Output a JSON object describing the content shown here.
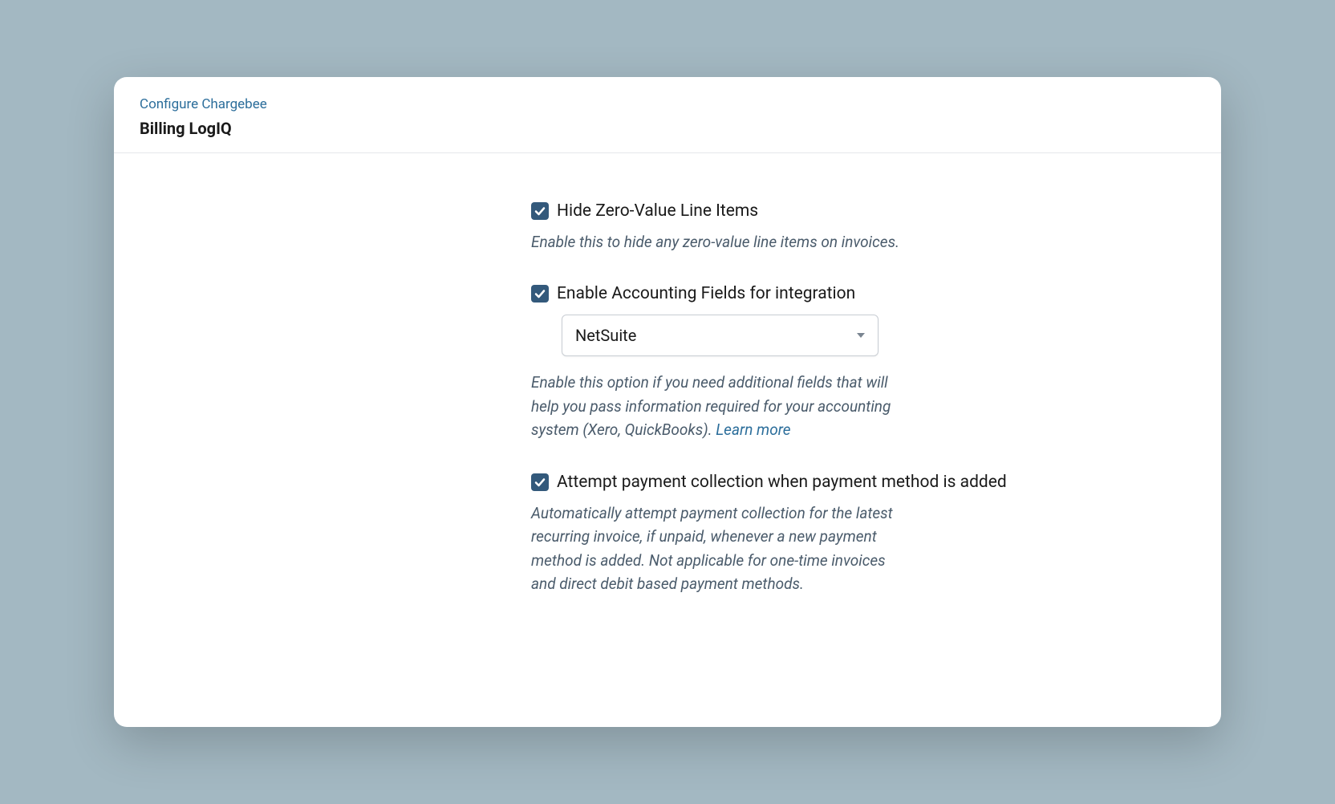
{
  "header": {
    "breadcrumb": "Configure Chargebee",
    "title": "Billing LogIQ"
  },
  "settings": {
    "hideZeroValue": {
      "label": "Hide Zero-Value Line Items",
      "description": "Enable this to hide any zero-value line items on invoices.",
      "checked": true
    },
    "accountingFields": {
      "label": "Enable Accounting Fields for integration",
      "selectedValue": "NetSuite",
      "description": "Enable this option if you need additional fields that will help you pass information required for your accounting system (Xero, QuickBooks).",
      "learnMore": "Learn more",
      "checked": true
    },
    "attemptPayment": {
      "label": "Attempt payment collection when payment method is added",
      "description": "Automatically attempt payment collection for the latest recurring invoice, if unpaid, whenever a new payment method is added. Not applicable for one-time invoices and direct debit based payment methods.",
      "checked": true
    }
  }
}
